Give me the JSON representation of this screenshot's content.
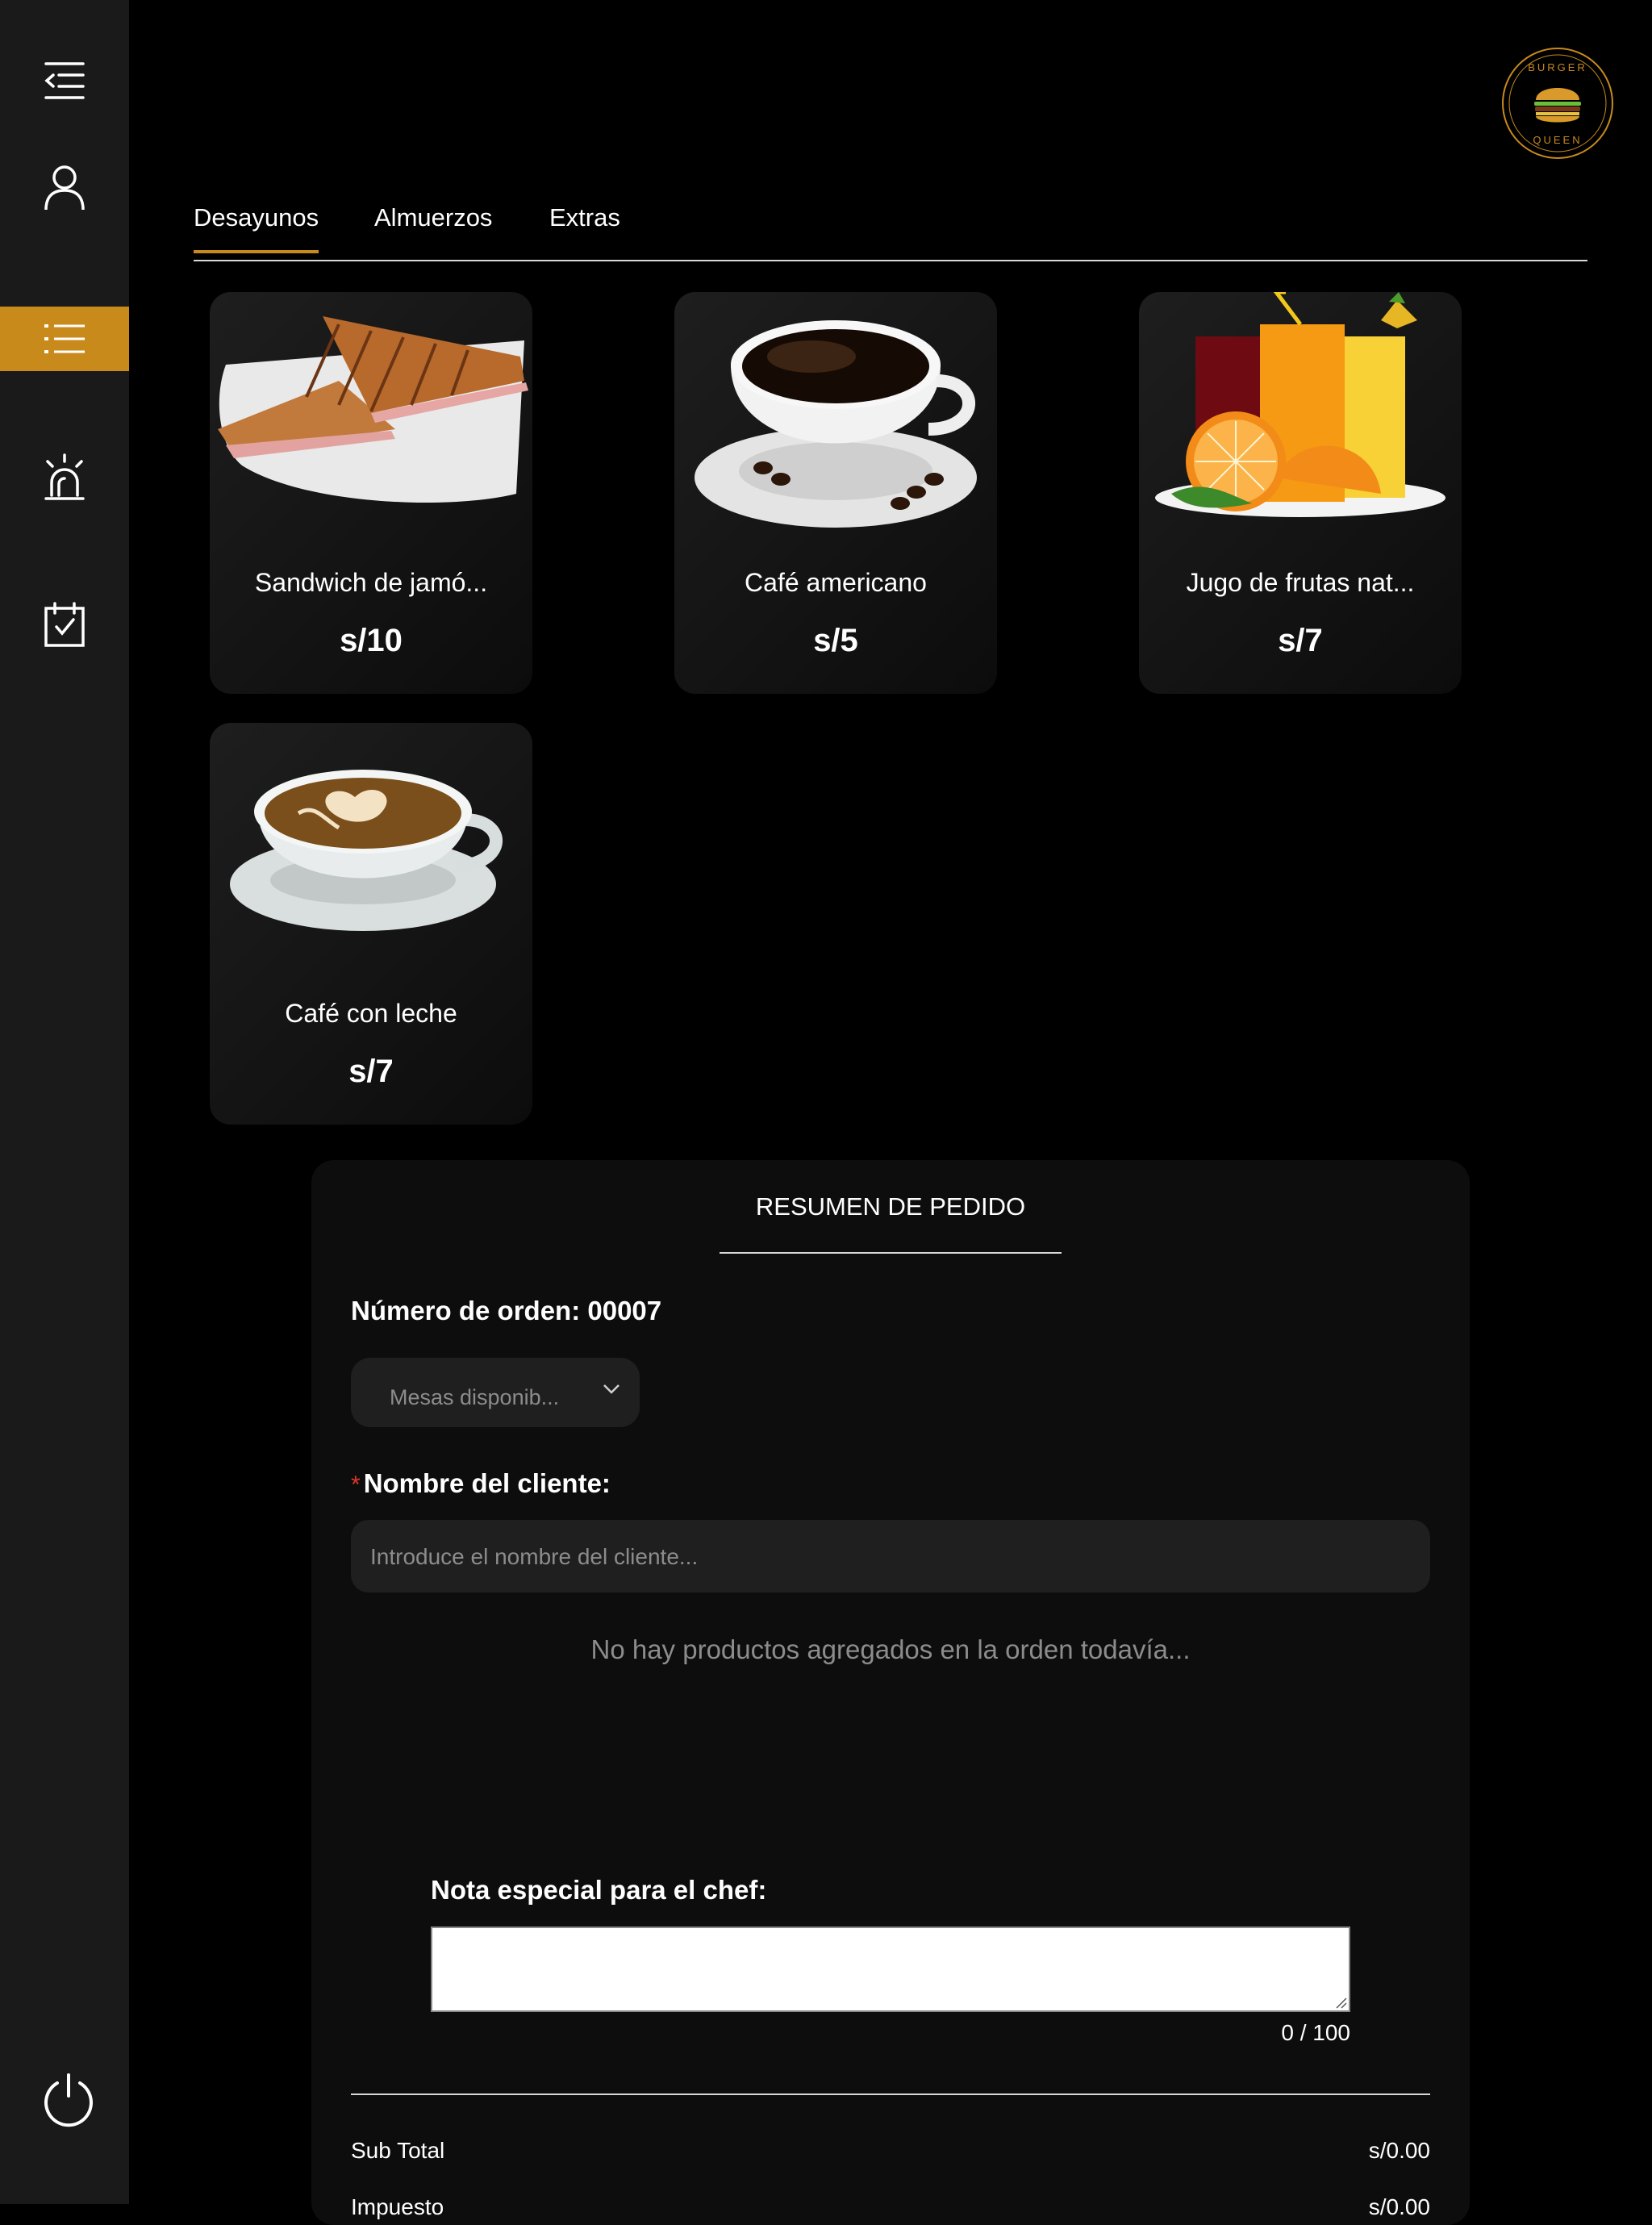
{
  "sidebar": {
    "items": [
      {
        "icon": "collapse-menu-icon"
      },
      {
        "icon": "user-icon"
      },
      {
        "icon": "list-icon",
        "active": true
      },
      {
        "icon": "alarm-icon"
      },
      {
        "icon": "calendar-check-icon"
      },
      {
        "icon": "power-icon"
      }
    ],
    "accent": "#c98a1c"
  },
  "logo": {
    "top_text": "BURGER",
    "bottom_text": "QUEEN"
  },
  "tabs": [
    {
      "label": "Desayunos",
      "active": true
    },
    {
      "label": "Almuerzos",
      "active": false
    },
    {
      "label": "Extras",
      "active": false
    }
  ],
  "products": [
    {
      "name": "Sandwich de jamó...",
      "price": "s/10",
      "image": "sandwich"
    },
    {
      "name": "Café americano",
      "price": "s/5",
      "image": "coffee-cup"
    },
    {
      "name": "Jugo de frutas nat...",
      "price": "s/7",
      "image": "juice-glasses"
    },
    {
      "name": "Café con leche",
      "price": "s/7",
      "image": "latte-cup"
    }
  ],
  "summary": {
    "title": "RESUMEN DE PEDIDO",
    "order_number": "Número de orden: 00007",
    "tables_placeholder": "Mesas disponib...",
    "client_required_mark": "*",
    "client_label": "Nombre del cliente:",
    "client_placeholder": "Introduce el nombre del cliente...",
    "empty_message": "No hay productos agregados en la orden todavía...",
    "note_label": "Nota especial para el chef:",
    "note_counter": "0 / 100",
    "subtotal_label": "Sub Total",
    "subtotal_value": "s/0.00",
    "tax_label": "Impuesto",
    "tax_value": "s/0.00"
  }
}
